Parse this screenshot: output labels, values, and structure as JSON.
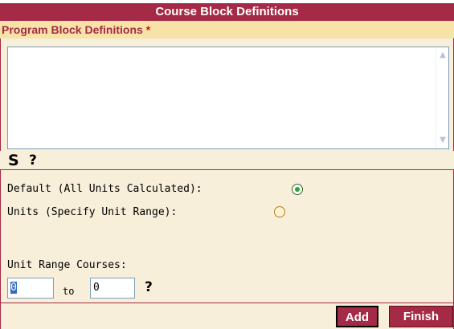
{
  "header": {
    "title": "Course Block Definitions"
  },
  "program_block": {
    "label": "Program Block Definitions",
    "required_marker": "*",
    "value": ""
  },
  "toolbar": {
    "s_icon": "S",
    "help_icon": "?"
  },
  "options": {
    "default_label": "Default (All Units Calculated):",
    "units_label": "Units (Specify Unit Range):",
    "selected": "default"
  },
  "unit_range": {
    "label": "Unit Range Courses:",
    "from_value": "0",
    "to_label": "to",
    "to_value": "0",
    "help_icon": "?"
  },
  "buttons": {
    "add": "Add",
    "finish": "Finish"
  },
  "colors": {
    "title_bg": "#a52a45",
    "panel_bg": "#f7efd9",
    "label_band": "#f7e3a8"
  }
}
